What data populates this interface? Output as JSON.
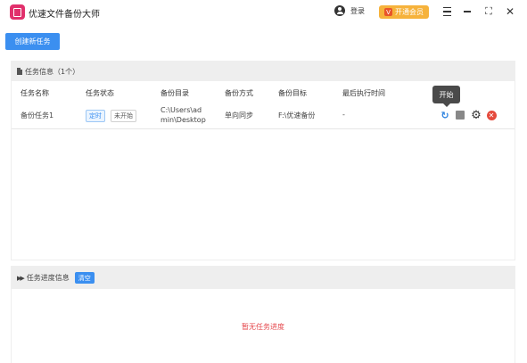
{
  "window": {
    "title": "优速文件备份大师",
    "login_label": "登录",
    "vip_icon_char": "V",
    "vip_label": "开通会员",
    "max_symbol": "⛶",
    "close_symbol": "✕"
  },
  "toolbar": {
    "create_label": "创建新任务"
  },
  "task_panel": {
    "header": "任务信息（1个）",
    "columns": [
      "任务名称",
      "任务状态",
      "备份目录",
      "备份方式",
      "备份目标",
      "最后执行时间"
    ],
    "rows": [
      {
        "name": "备份任务1",
        "badge_type": "定时",
        "status": "未开始",
        "source_line1": "C:\\Users\\ad",
        "source_line2": "min\\Desktop",
        "method": "单向同步",
        "target": "F:\\优速备份",
        "last_run": "-"
      }
    ],
    "actions": {
      "refresh_symbol": "↻",
      "gear_symbol": "⚙",
      "close_symbol": "✕"
    },
    "tooltip": "开始"
  },
  "progress_panel": {
    "header": "任务进度信息",
    "icon_symbol": "▶▶",
    "clear_label": "清空",
    "empty_text": "暂无任务进度"
  },
  "colors": {
    "accent": "#3b8ff0",
    "vip": "#f6b23b",
    "danger": "#e54a3c",
    "logo": "#e1306c"
  }
}
